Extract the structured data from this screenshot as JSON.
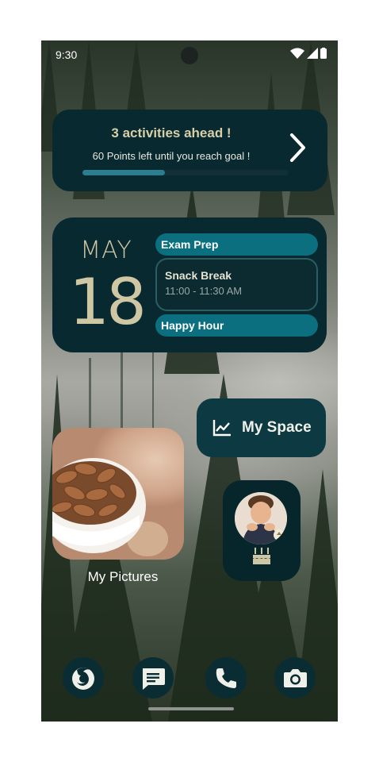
{
  "status_bar": {
    "time": "9:30"
  },
  "activity_widget": {
    "title": "3 activities ahead !",
    "subtitle": "60 Points left until you reach goal !",
    "progress": 0.4,
    "chevron_icon": "chevron-right-icon"
  },
  "calendar_widget": {
    "month": "MAY",
    "day": "18",
    "events": [
      {
        "title": "Exam Prep"
      },
      {
        "title": "Snack Break",
        "time": "11:00 - 11:30 AM"
      },
      {
        "title": "Happy Hour"
      }
    ]
  },
  "my_space": {
    "label": "My Space",
    "icon": "chart-line-icon"
  },
  "pictures_widget": {
    "label": "My Pictures"
  },
  "birthday_widget": {
    "icon": "cake-icon"
  },
  "dock": [
    {
      "name": "firefox-icon"
    },
    {
      "name": "messages-icon"
    },
    {
      "name": "phone-icon"
    },
    {
      "name": "camera-icon"
    }
  ],
  "colors": {
    "widget_bg": "#08292f",
    "accent": "#0b6f80",
    "title_text": "#d8cfa8"
  }
}
